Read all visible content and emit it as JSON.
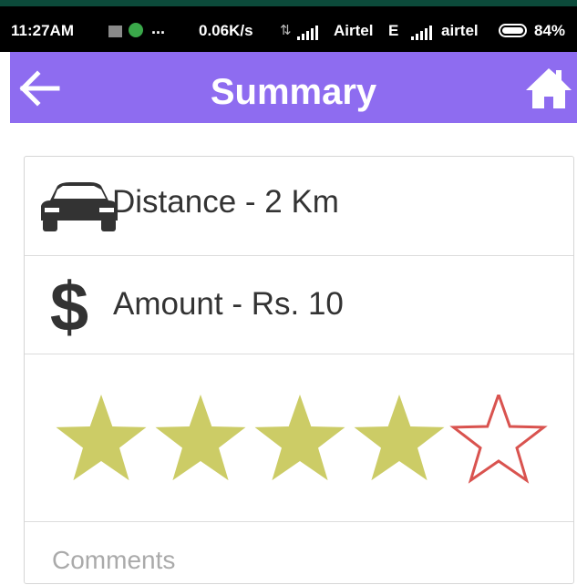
{
  "status_bar": {
    "time": "11:27AM",
    "dots": "...",
    "speed": "0.06K/s",
    "operator_1": "Airtel",
    "network_type": "E",
    "operator_2": "airtel",
    "battery": "84%"
  },
  "app_bar": {
    "title": "Summary",
    "background_color": "#8e6cf0",
    "back_icon": "arrow-left-icon",
    "home_icon": "home-icon"
  },
  "summary": {
    "distance_label": "Distance - 2 Km",
    "distance_icon": "car-icon",
    "amount_label": "Amount - Rs. 10",
    "amount_icon": "dollar-icon"
  },
  "rating": {
    "value": 4,
    "max": 5,
    "filled_color": "#cccc66",
    "empty_outline_color": "#d9534f"
  },
  "comments": {
    "placeholder": "Comments"
  }
}
